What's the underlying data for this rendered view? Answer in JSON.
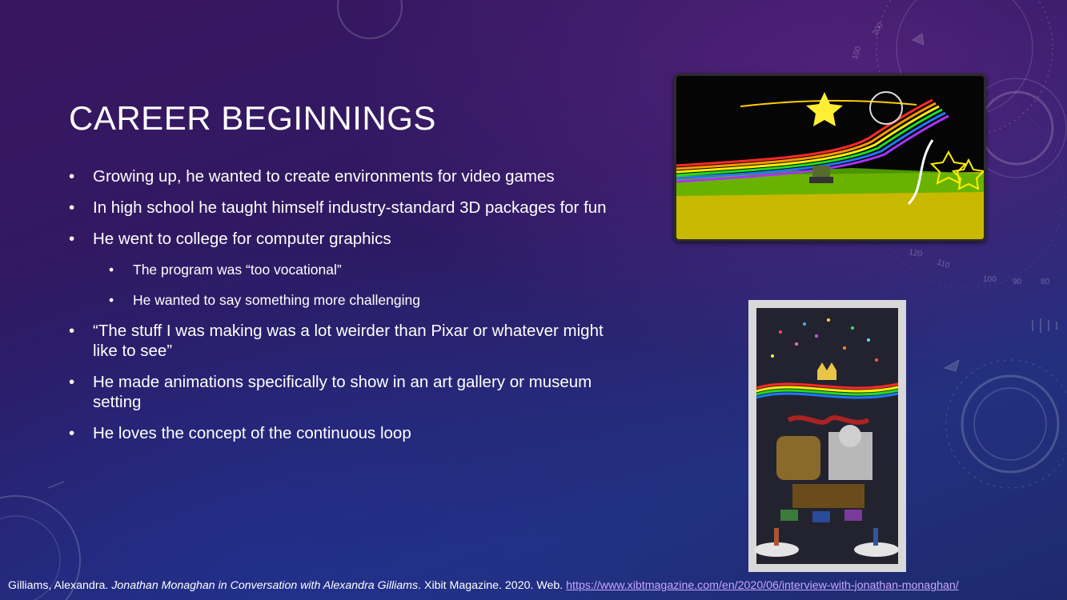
{
  "slide": {
    "title": "CAREER BEGINNINGS",
    "bullets": [
      {
        "level": 1,
        "text": "Growing up, he wanted to create environments for video games"
      },
      {
        "level": 1,
        "text": "In high school he taught himself industry-standard 3D packages for fun"
      },
      {
        "level": 1,
        "text": "He went to college for computer graphics"
      },
      {
        "level": 2,
        "text": "The program was “too vocational”"
      },
      {
        "level": 2,
        "text": "He wanted to say something more challenging"
      },
      {
        "level": 1,
        "text": "“The stuff I was making was a lot weirder than Pixar or whatever might like to see”"
      },
      {
        "level": 1,
        "text": "He made animations specifically to show in an art gallery or museum setting"
      },
      {
        "level": 1,
        "text": "He loves the concept of the continuous loop"
      }
    ],
    "bullet_glyph": "•"
  },
  "citation": {
    "author": "Gilliams, Alexandra. ",
    "title": "Jonathan Monaghan in Conversation with Alexandra Gilliams",
    "publication": ". Xibit Magazine. 2020. Web. ",
    "url": "https://www.xibtmagazine.com/en/2020/06/interview-with-jonathan-monaghan/"
  },
  "decor": {
    "dial_numbers": [
      "100",
      "200",
      "110",
      "120",
      "100",
      "90",
      "80"
    ]
  },
  "colors": {
    "link": "#c9a6ff",
    "rainbow": [
      "#ff2a2a",
      "#ff9a00",
      "#ffee00",
      "#22dd22",
      "#2277ff",
      "#aa33ff"
    ]
  }
}
